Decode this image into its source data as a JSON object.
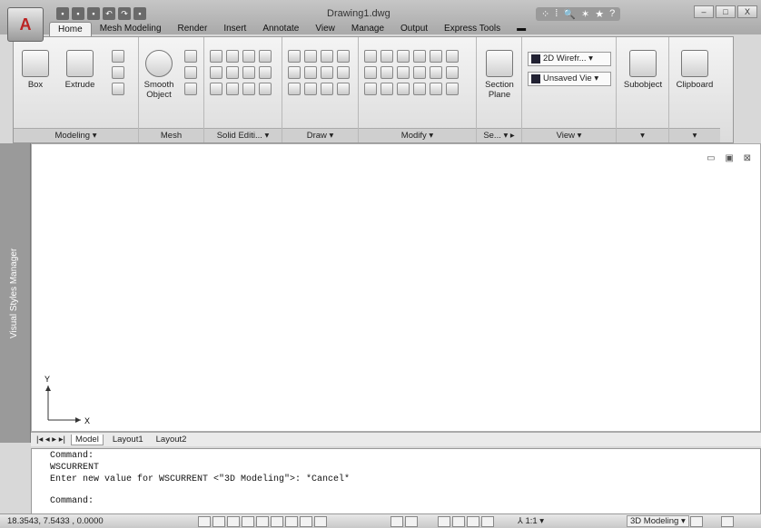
{
  "app": {
    "logo_glyph": "A",
    "document_title": "Drawing1.dwg"
  },
  "window_controls": {
    "minimize": "–",
    "maximize": "□",
    "close": "X"
  },
  "quick_access": [
    "▪",
    "▪",
    "▪",
    "↶",
    "↷",
    "▪"
  ],
  "infocenter": {
    "items": [
      "⁘",
      "⁞",
      "🔍",
      "✶",
      "★",
      "?"
    ]
  },
  "tabs": [
    "Home",
    "Mesh Modeling",
    "Render",
    "Insert",
    "Annotate",
    "View",
    "Manage",
    "Output",
    "Express Tools",
    "▬"
  ],
  "active_tab": "Home",
  "ribbon": {
    "modeling": {
      "title": "Modeling ▾",
      "box_label": "Box",
      "extrude_label": "Extrude"
    },
    "mesh": {
      "title": "Mesh",
      "smooth_label_1": "Smooth",
      "smooth_label_2": "Object"
    },
    "solid_editing": {
      "title": "Solid Editi... ▾"
    },
    "draw": {
      "title": "Draw ▾"
    },
    "modify": {
      "title": "Modify ▾"
    },
    "section": {
      "title": "Se... ▾ ▸",
      "label_1": "Section",
      "label_2": "Plane"
    },
    "view": {
      "title": "View ▾",
      "visual_style": "2D Wirefr... ▾",
      "saved_view": "Unsaved Vie ▾"
    },
    "subobject": {
      "label": "Subobject",
      "title": "▾"
    },
    "clipboard": {
      "label": "Clipboard",
      "title": "▾"
    }
  },
  "sidebar": {
    "label": "Visual Styles Manager"
  },
  "viewport": {
    "controls": "▭ ▣ ⊠",
    "ucs_y": "Y",
    "ucs_x": "X"
  },
  "layout_tabs": {
    "nav": "|◂ ◂ ▸ ▸|",
    "tabs": [
      "Model",
      "Layout1",
      "Layout2"
    ],
    "active": "Model"
  },
  "command_window": {
    "lines": [
      "Command:",
      "WSCURRENT",
      "Enter new value for WSCURRENT <\"3D Modeling\">: *Cancel*"
    ],
    "prompt": "Command:"
  },
  "statusbar": {
    "coords": "18.3543, 7.5433 , 0.0000",
    "scale": "⅄ 1:1 ▾",
    "workspace": "3D Modeling ▾"
  }
}
